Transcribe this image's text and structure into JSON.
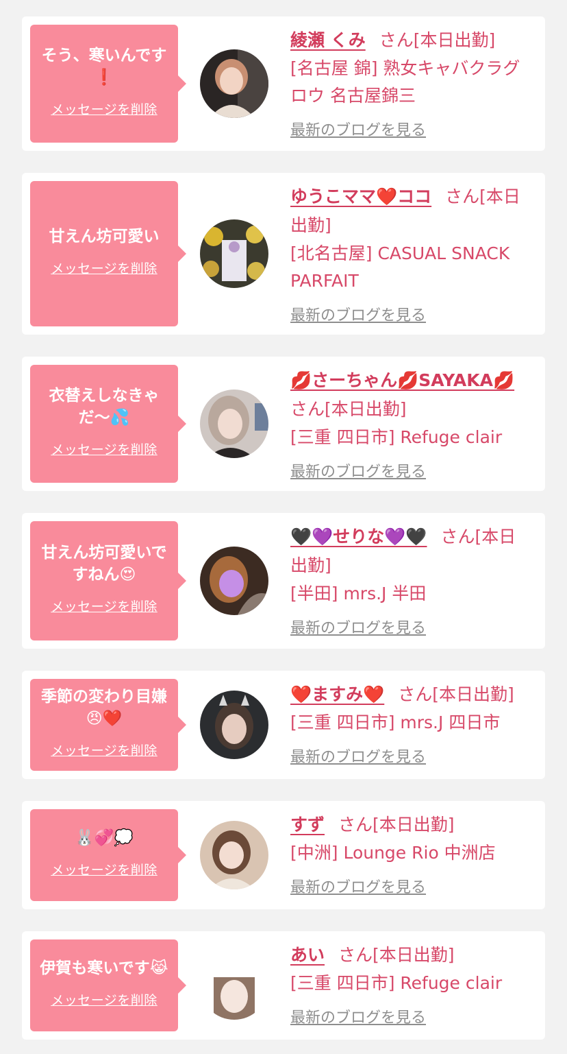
{
  "cards": [
    {
      "message": "そう、寒いんです❗️",
      "delete_label": "メッセージを削除",
      "name": "綾瀬 くみ",
      "san_status": "さん[本日出勤]",
      "shop": "[名古屋 錦] 熟女キャバクラグロウ 名古屋錦三",
      "blog_label": "最新のブログを見る"
    },
    {
      "message": "甘えん坊可愛い",
      "delete_label": "メッセージを削除",
      "name": "ゆうこママ❤️ココ",
      "san_status": "さん[本日出勤]",
      "shop": "[北名古屋] CASUAL SNACK PARFAIT",
      "blog_label": "最新のブログを見る"
    },
    {
      "message": "衣替えしなきゃだ〜💦",
      "delete_label": "メッセージを削除",
      "name": "💋さーちゃん💋SAYAKA💋",
      "san_status": "さん[本日出勤]",
      "shop": "[三重 四日市] Refuge clair",
      "blog_label": "最新のブログを見る"
    },
    {
      "message": "甘えん坊可愛いですねん😍",
      "delete_label": "メッセージを削除",
      "name": "🖤💜せりな💜🖤",
      "san_status": "さん[本日出勤]",
      "shop": "[半田] mrs.J 半田",
      "blog_label": "最新のブログを見る"
    },
    {
      "message": "季節の変わり目嫌😠❤️",
      "delete_label": "メッセージを削除",
      "name": "❤️ますみ❤️",
      "san_status": "さん[本日出勤]",
      "shop": "[三重 四日市] mrs.J 四日市",
      "blog_label": "最新のブログを見る"
    },
    {
      "message": "🐰💞💭",
      "delete_label": "メッセージを削除",
      "name": "すず",
      "san_status": "さん[本日出勤]",
      "shop": "[中洲] Lounge Rio 中洲店",
      "blog_label": "最新のブログを見る"
    },
    {
      "message": "伊賀も寒いです😹",
      "delete_label": "メッセージを削除",
      "name": "あい",
      "san_status": "さん[本日出勤]",
      "shop": "[三重 四日市] Refuge clair",
      "blog_label": "最新のブログを見る"
    }
  ]
}
